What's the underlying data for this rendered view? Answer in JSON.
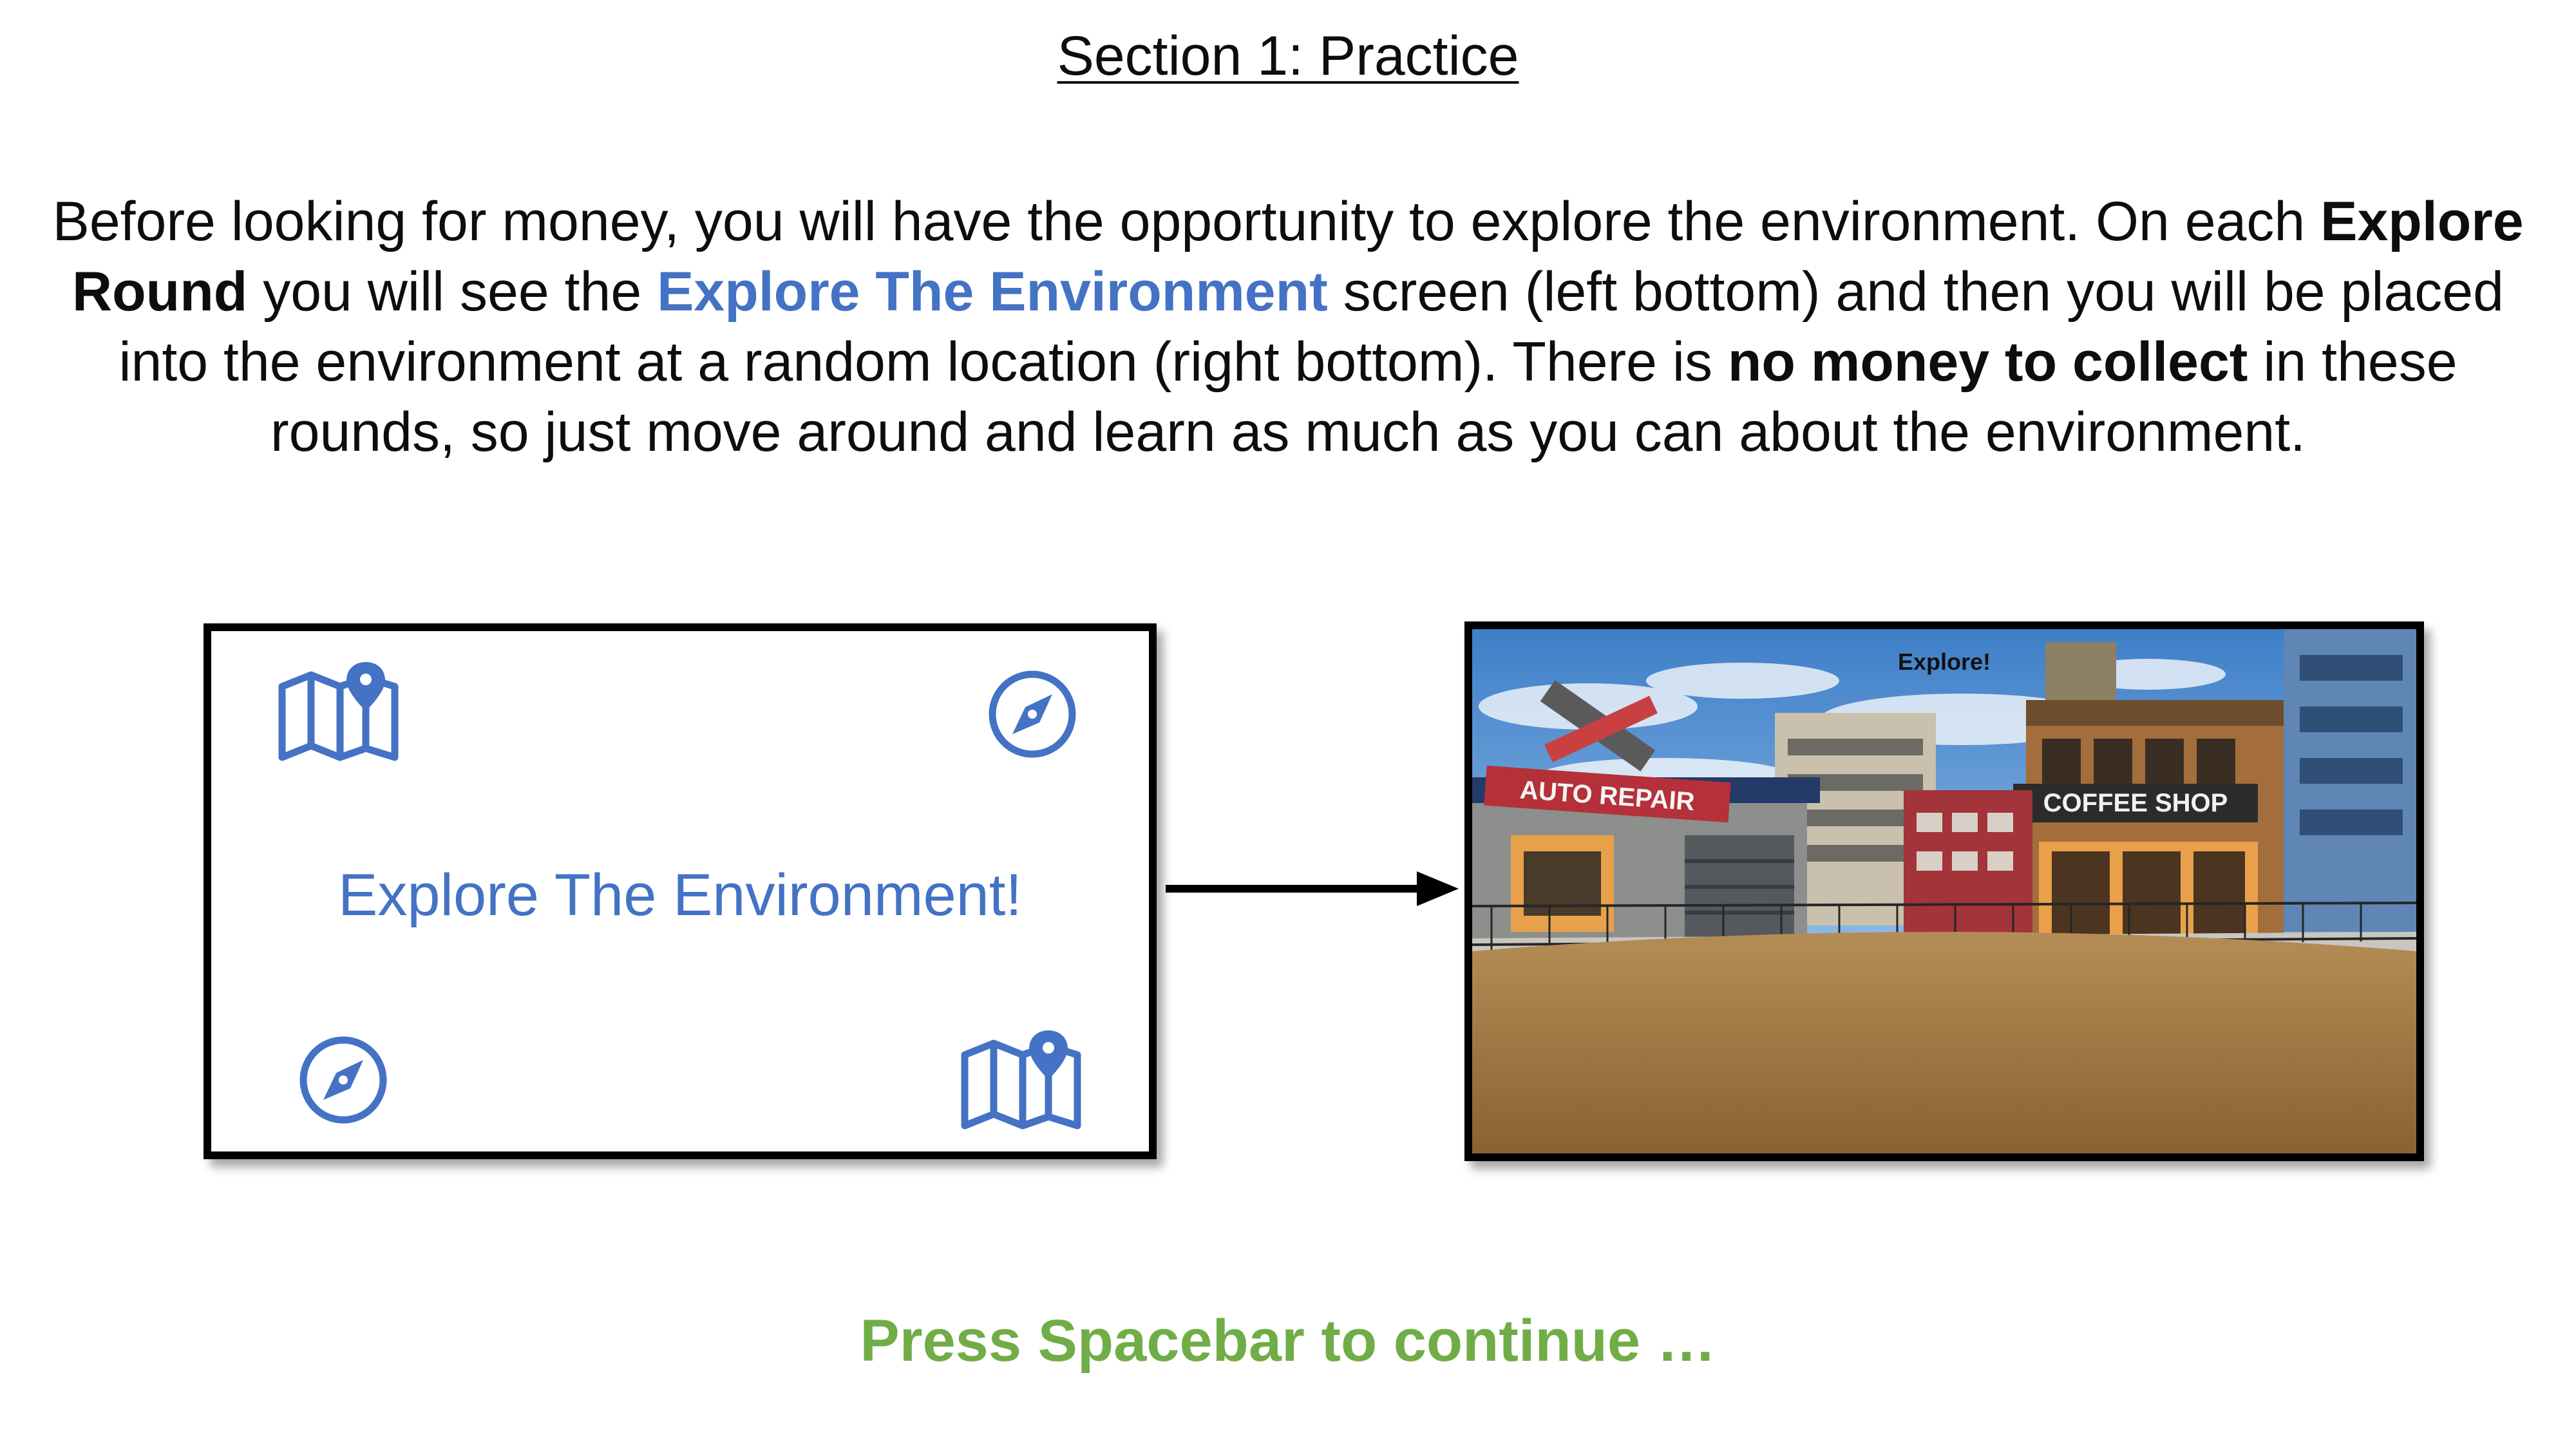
{
  "page": {
    "title": "Section 1: Practice",
    "instructions": {
      "p1": "Before looking for money, you will have the opportunity to explore the environment. On each ",
      "b1": "Explore Round",
      "p2": " you will see the ",
      "b2": "Explore The Environment",
      "p3": " screen (left bottom) and then you will be placed into the environment at a random location (right bottom). There is ",
      "b3": "no money to collect",
      "p4": " in these rounds, so just move around and learn as much as you can about the environment."
    },
    "continue_prompt": "Press Spacebar to continue …"
  },
  "left_screen": {
    "caption": "Explore The Environment!",
    "icons": [
      "map-pin-icon",
      "compass-icon",
      "compass-icon",
      "map-pin-icon"
    ],
    "icon_color": "#4472c4"
  },
  "right_screen": {
    "overlay_label": "Explore!",
    "signs": {
      "auto_repair": "AUTO REPAIR",
      "coffee_shop": "COFFEE SHOP"
    }
  },
  "colors": {
    "accent_blue": "#4472c4",
    "continue_green": "#70ad47"
  }
}
